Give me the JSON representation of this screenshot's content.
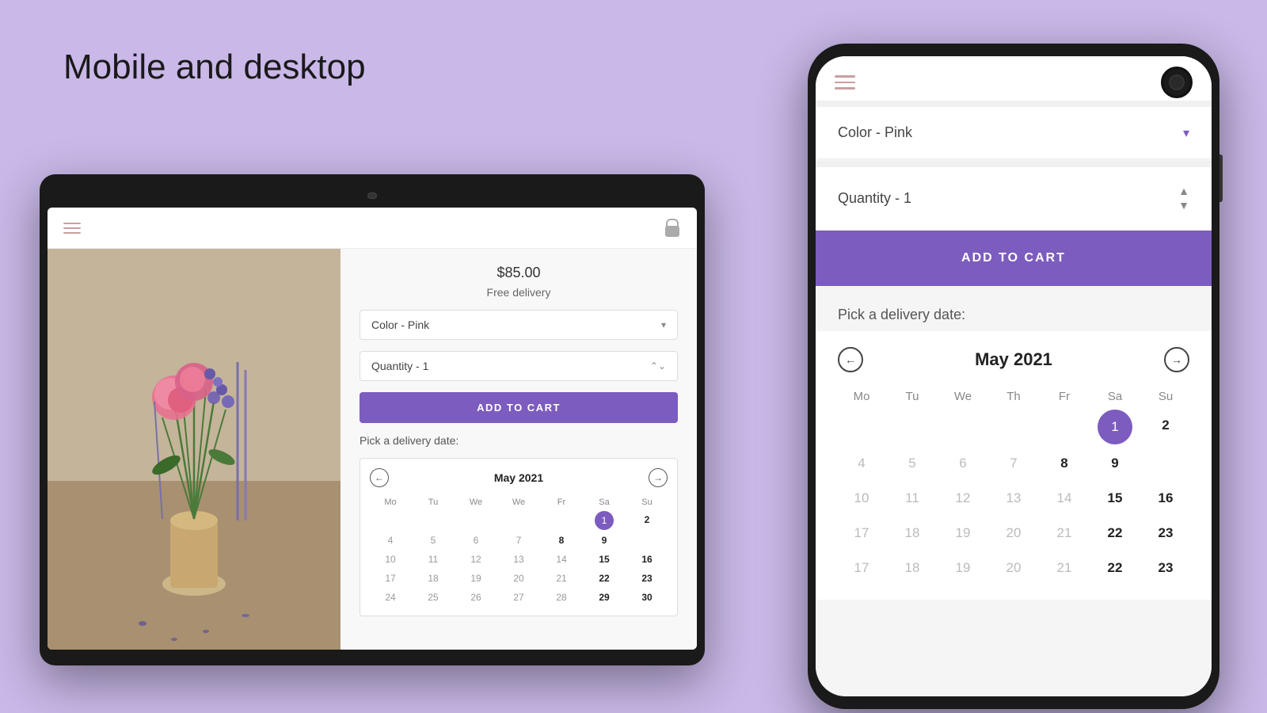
{
  "page": {
    "title": "Mobile and desktop",
    "bg_color": "#c9b8e8"
  },
  "tablet": {
    "price": "$85.00",
    "delivery": "Free delivery",
    "color_label": "Color - Pink",
    "quantity_label": "Quantity - 1",
    "add_to_cart": "ADD TO CART",
    "delivery_date_label": "Pick a delivery date:",
    "calendar": {
      "month": "May 2021",
      "day_headers": [
        "Mo",
        "Tu",
        "We",
        "We",
        "Fr",
        "Sa",
        "Su"
      ],
      "days": [
        {
          "day": "",
          "type": "empty"
        },
        {
          "day": "",
          "type": "empty"
        },
        {
          "day": "",
          "type": "empty"
        },
        {
          "day": "",
          "type": "empty"
        },
        {
          "day": "",
          "type": "empty"
        },
        {
          "day": "1",
          "type": "active"
        },
        {
          "day": "2",
          "type": "bold"
        },
        {
          "day": "4",
          "type": "normal"
        },
        {
          "day": "5",
          "type": "normal"
        },
        {
          "day": "6",
          "type": "normal"
        },
        {
          "day": "7",
          "type": "normal"
        },
        {
          "day": "8",
          "type": "bold"
        },
        {
          "day": "9",
          "type": "bold"
        },
        {
          "day": "",
          "type": "empty"
        },
        {
          "day": "10",
          "type": "normal"
        },
        {
          "day": "11",
          "type": "normal"
        },
        {
          "day": "12",
          "type": "normal"
        },
        {
          "day": "13",
          "type": "normal"
        },
        {
          "day": "14",
          "type": "normal"
        },
        {
          "day": "15",
          "type": "bold"
        },
        {
          "day": "16",
          "type": "bold"
        },
        {
          "day": "17",
          "type": "normal"
        },
        {
          "day": "18",
          "type": "normal"
        },
        {
          "day": "19",
          "type": "normal"
        },
        {
          "day": "20",
          "type": "normal"
        },
        {
          "day": "21",
          "type": "normal"
        },
        {
          "day": "22",
          "type": "bold"
        },
        {
          "day": "23",
          "type": "bold"
        },
        {
          "day": "24",
          "type": "normal"
        },
        {
          "day": "25",
          "type": "normal"
        },
        {
          "day": "26",
          "type": "normal"
        },
        {
          "day": "27",
          "type": "normal"
        },
        {
          "day": "28",
          "type": "normal"
        },
        {
          "day": "29",
          "type": "bold"
        },
        {
          "day": "30",
          "type": "bold"
        }
      ]
    }
  },
  "phone": {
    "color_label": "Color - Pink",
    "quantity_label": "Quantity - 1",
    "add_to_cart": "ADD TO CART",
    "delivery_date_label": "Pick a delivery date:",
    "calendar": {
      "month": "May 2021",
      "day_headers": [
        "Mo",
        "Tu",
        "We",
        "Th",
        "Fr",
        "Sa",
        "Su"
      ],
      "days": [
        {
          "day": "",
          "type": "empty"
        },
        {
          "day": "",
          "type": "empty"
        },
        {
          "day": "",
          "type": "empty"
        },
        {
          "day": "",
          "type": "empty"
        },
        {
          "day": "",
          "type": "empty"
        },
        {
          "day": "1",
          "type": "active"
        },
        {
          "day": "2",
          "type": "bold"
        },
        {
          "day": "4",
          "type": "normal"
        },
        {
          "day": "5",
          "type": "normal"
        },
        {
          "day": "6",
          "type": "normal"
        },
        {
          "day": "7",
          "type": "normal"
        },
        {
          "day": "8",
          "type": "bold"
        },
        {
          "day": "9",
          "type": "bold"
        },
        {
          "day": "",
          "type": "empty"
        },
        {
          "day": "10",
          "type": "normal"
        },
        {
          "day": "11",
          "type": "normal"
        },
        {
          "day": "12",
          "type": "normal"
        },
        {
          "day": "13",
          "type": "normal"
        },
        {
          "day": "14",
          "type": "normal"
        },
        {
          "day": "15",
          "type": "bold"
        },
        {
          "day": "16",
          "type": "bold"
        },
        {
          "day": "17",
          "type": "normal"
        },
        {
          "day": "18",
          "type": "normal"
        },
        {
          "day": "19",
          "type": "normal"
        },
        {
          "day": "20",
          "type": "normal"
        },
        {
          "day": "21",
          "type": "normal"
        },
        {
          "day": "22",
          "type": "bold"
        },
        {
          "day": "23",
          "type": "bold"
        },
        {
          "day": "17",
          "type": "normal"
        },
        {
          "day": "18",
          "type": "normal"
        },
        {
          "day": "19",
          "type": "normal"
        },
        {
          "day": "20",
          "type": "normal"
        },
        {
          "day": "21",
          "type": "normal"
        },
        {
          "day": "22",
          "type": "bold"
        },
        {
          "day": "23",
          "type": "bold"
        }
      ]
    }
  }
}
